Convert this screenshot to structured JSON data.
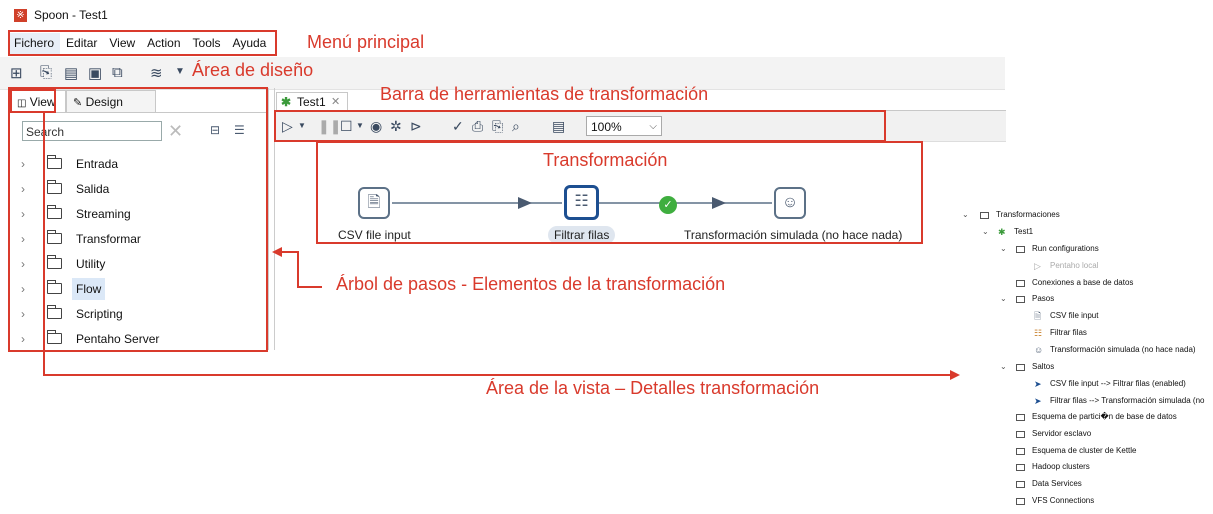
{
  "window": {
    "title": "Spoon - Test1"
  },
  "menu": [
    "Fichero",
    "Editar",
    "View",
    "Action",
    "Tools",
    "Ayuda"
  ],
  "main_toolbar_icons": [
    "new-file-icon",
    "open-file-icon",
    "explore-repo-icon",
    "save-icon",
    "save-as-icon",
    "layers-icon",
    "chevron-down-icon"
  ],
  "left_panel": {
    "tabs": [
      "View",
      "Design"
    ],
    "search_placeholder": "Search",
    "tree_items": [
      "Entrada",
      "Salida",
      "Streaming",
      "Transformar",
      "Utility",
      "Flow",
      "Scripting",
      "Pentaho Server"
    ],
    "selected": "Flow"
  },
  "canvas": {
    "tab_label": "Test1",
    "zoom": "100%",
    "steps": [
      {
        "name": "CSV file input",
        "icon": "csv-file-icon"
      },
      {
        "name": "Filtrar filas",
        "icon": "filter-rows-icon"
      },
      {
        "name": "Transformación simulada (no hace nada)",
        "icon": "dummy-transform-icon"
      }
    ]
  },
  "annotations": {
    "menu": "Menú principal",
    "design": "Área de diseño",
    "trans_toolbar": "Barra de herramientas de transformación",
    "transformation": "Transformación",
    "steps_tree": "Árbol de pasos - Elementos de la transformación",
    "view_area": "Área de la vista – Detalles transformación"
  },
  "view_tree": {
    "root": "Transformaciones",
    "transformation": "Test1",
    "run_configs": "Run configurations",
    "run_config_item": "Pentaho local",
    "db_connections": "Conexiones a base de datos",
    "steps_folder": "Pasos",
    "steps": [
      "CSV file input",
      "Filtrar filas",
      "Transformación simulada (no hace nada)"
    ],
    "hops_folder": "Saltos",
    "hops": [
      "CSV file input --> Filtrar filas (enabled)",
      "Filtrar filas --> Transformación simulada (no"
    ],
    "others": [
      "Esquema de partici�n de base de datos",
      "Servidor esclavo",
      "Esquema de cluster de Kettle",
      "Hadoop clusters",
      "Data Services",
      "VFS Connections"
    ]
  },
  "colors": {
    "annotation": "#d93a2c",
    "selected_step": "#1d4f91",
    "hop_ok": "#3fae3f"
  }
}
